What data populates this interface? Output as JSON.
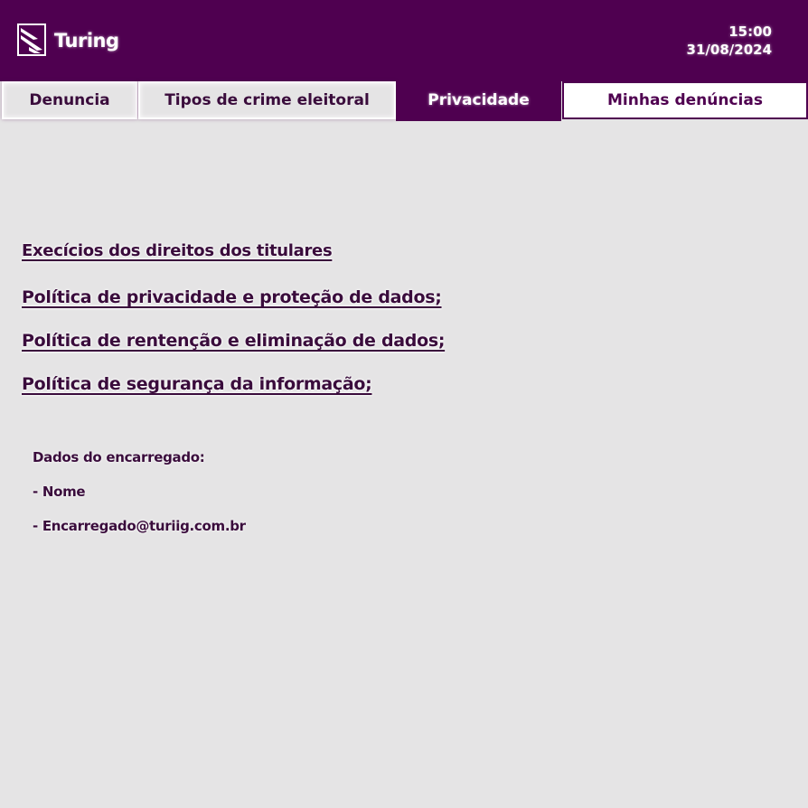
{
  "header": {
    "app_title": "Turing",
    "time": "15:00",
    "date": "31/08/2024",
    "logo_icon": "turing-logo-icon",
    "background_color": "#4f0050"
  },
  "tabs": [
    {
      "label": "Denuncia",
      "state": "inactive"
    },
    {
      "label": "Tipos de crime eleitoral",
      "state": "inactive"
    },
    {
      "label": "Privacidade",
      "state": "active"
    },
    {
      "label": "Minhas denúncias",
      "state": "outlined"
    }
  ],
  "main": {
    "links": [
      "Execícios dos direitos  dos titulares",
      "Política de privacidade e proteção de dados;",
      "Política de rentenção e eliminação de dados;",
      "Política de segurança da informação;"
    ],
    "contact": {
      "heading": "Dados do encarregado:",
      "name": "- Nome",
      "email": "- Encarregado@turiig.com.br"
    }
  },
  "colors": {
    "accent": "#4f0050",
    "text": "#3a0c3c",
    "background": "#e5e4e5"
  }
}
